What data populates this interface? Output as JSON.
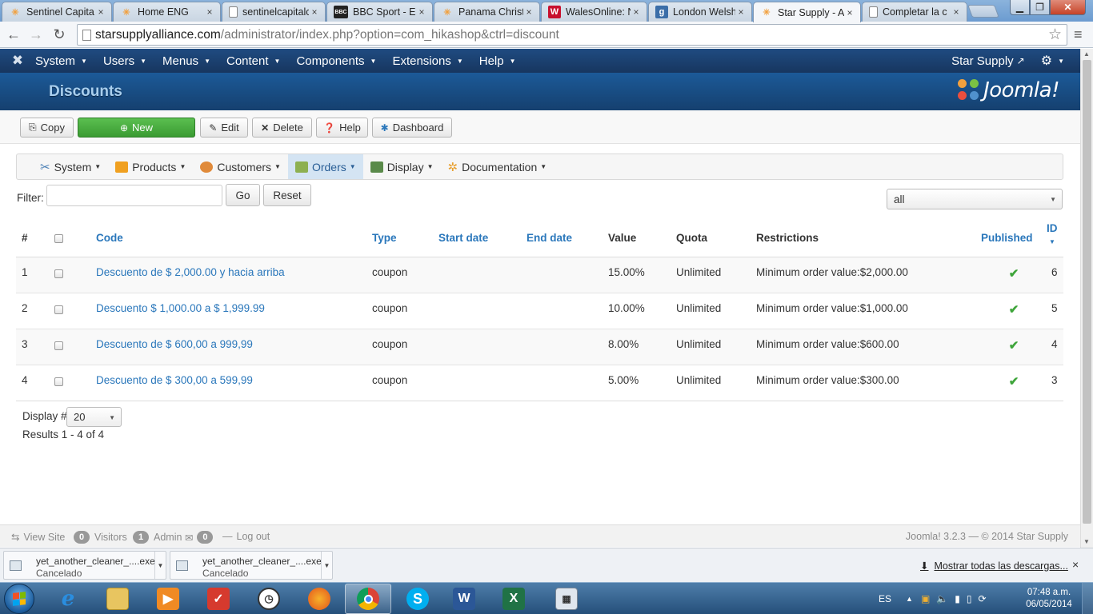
{
  "browser": {
    "tabs": [
      {
        "label": "Sentinel Capita",
        "icon": "joomla-icon",
        "color": "#f2a03d"
      },
      {
        "label": "Home ENG",
        "icon": "joomla-icon",
        "color": "#f2a03d"
      },
      {
        "label": "sentinelcapitalc",
        "icon": "page-icon",
        "color": "#888888"
      },
      {
        "label": "BBC Sport - En",
        "icon": "bbc-icon",
        "color": "#222222"
      },
      {
        "label": "Panama Christi",
        "icon": "joomla-icon",
        "color": "#f2a03d"
      },
      {
        "label": "WalesOnline: N",
        "icon": "walesonline-icon",
        "color": "#c8102e"
      },
      {
        "label": "London Welsh",
        "icon": "g-icon",
        "color": "#3b6ea8"
      },
      {
        "label": "Star Supply - A",
        "icon": "joomla-icon",
        "color": "#f2a03d"
      },
      {
        "label": "Completar la c",
        "icon": "page-icon",
        "color": "#888888"
      }
    ],
    "close_glyph": "×",
    "url_host": "starsupplyalliance.com",
    "url_path": "/administrator/index.php?option=com_hikashop&ctrl=discount"
  },
  "admin_nav": {
    "items": [
      "System",
      "Users",
      "Menus",
      "Content",
      "Components",
      "Extensions",
      "Help"
    ],
    "site_link": "Star Supply",
    "gear": "gear-icon"
  },
  "header": {
    "page_title": "Discounts",
    "brand": "Joomla!"
  },
  "toolbar": {
    "copy": "Copy",
    "new": "New",
    "edit": "Edit",
    "delete": "Delete",
    "help": "Help",
    "dashboard": "Dashboard"
  },
  "hikashop_menu": [
    {
      "label": "System",
      "icon_color": "#4a7fb5"
    },
    {
      "label": "Products",
      "icon_color": "#f0a020"
    },
    {
      "label": "Customers",
      "icon_color": "#e08a3a"
    },
    {
      "label": "Orders",
      "icon_color": "#8db050"
    },
    {
      "label": "Display",
      "icon_color": "#5a8a4a"
    },
    {
      "label": "Documentation",
      "icon_color": "#e8a030"
    }
  ],
  "filter": {
    "label": "Filter:",
    "value": "",
    "go": "Go",
    "reset": "Reset",
    "type_select": "all"
  },
  "table": {
    "headers": {
      "num": "#",
      "code": "Code",
      "type": "Type",
      "start": "Start date",
      "end": "End date",
      "value": "Value",
      "quota": "Quota",
      "restrictions": "Restrictions",
      "published": "Published",
      "id": "ID"
    },
    "rows": [
      {
        "num": "1",
        "code": "Descuento de $ 2,000.00 y hacia arriba",
        "type": "coupon",
        "start": "",
        "end": "",
        "value": "15.00%",
        "quota": "Unlimited",
        "restrictions": "Minimum order value:$2,000.00",
        "published": "✔",
        "id": "6"
      },
      {
        "num": "2",
        "code": "Descuento $ 1,000.00 a $ 1,999.99",
        "type": "coupon",
        "start": "",
        "end": "",
        "value": "10.00%",
        "quota": "Unlimited",
        "restrictions": "Minimum order value:$1,000.00",
        "published": "✔",
        "id": "5"
      },
      {
        "num": "3",
        "code": "Descuento de $ 600,00 a 999,99",
        "type": "coupon",
        "start": "",
        "end": "",
        "value": "8.00%",
        "quota": "Unlimited",
        "restrictions": "Minimum order value:$600.00",
        "published": "✔",
        "id": "4"
      },
      {
        "num": "4",
        "code": "Descuento de $ 300,00 a 599,99",
        "type": "coupon",
        "start": "",
        "end": "",
        "value": "5.00%",
        "quota": "Unlimited",
        "restrictions": "Minimum order value:$300.00",
        "published": "✔",
        "id": "3"
      }
    ]
  },
  "pagination": {
    "display_label": "Display #",
    "display_value": "20",
    "results": "Results 1 - 4 of 4"
  },
  "status": {
    "view_site": "View Site",
    "visitors_count": "0",
    "visitors": "Visitors",
    "admin_count": "1",
    "admin": "Admin",
    "messages_count": "0",
    "logout": "Log out",
    "footer": "Joomla! 3.2.3 — © 2014 Star Supply"
  },
  "downloads": {
    "items": [
      {
        "name": "yet_another_cleaner_....exe",
        "status": "Cancelado"
      },
      {
        "name": "yet_another_cleaner_....exe",
        "status": "Cancelado"
      }
    ],
    "show_all": "Mostrar todas las descargas..."
  },
  "taskbar": {
    "language": "ES",
    "time": "07:48 a.m.",
    "date": "06/05/2014"
  }
}
